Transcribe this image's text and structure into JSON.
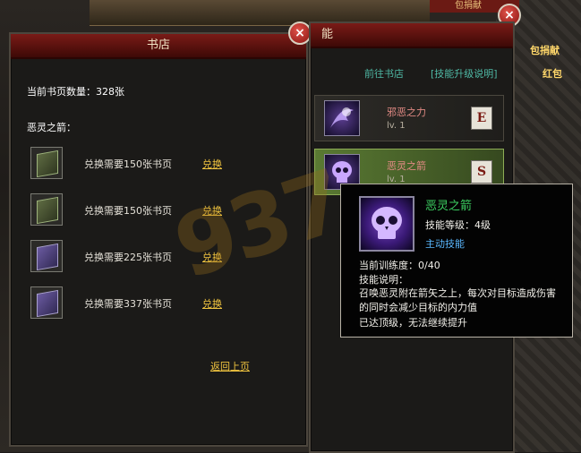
{
  "bookstore": {
    "title": "书店",
    "close_glyph": "×",
    "count_label": "当前书页数量：328张",
    "section_label": "恶灵之箭：",
    "items": [
      {
        "text": "兑换需要150张书页",
        "action": "兑换",
        "icon": "book-icon",
        "color": "#9db37b"
      },
      {
        "text": "兑换需要150张书页",
        "action": "兑换",
        "icon": "book-icon",
        "color": "#9db37b"
      },
      {
        "text": "兑换需要225张书页",
        "action": "兑换",
        "icon": "book-icon",
        "color": "#a89fce"
      },
      {
        "text": "兑换需要337张书页",
        "action": "兑换",
        "icon": "book-icon",
        "color": "#a89fce"
      }
    ],
    "back_link": "返回上页"
  },
  "skills": {
    "title_partial": "能",
    "close_glyph": "×",
    "goto_store": "前往书店",
    "upgrade_help": "[技能升级说明]",
    "list": [
      {
        "name": "邪恶之力",
        "level": "lv. 1",
        "key": "E",
        "icon": "evil-power-icon"
      },
      {
        "name": "恶灵之箭",
        "level": "lv. 1",
        "key": "S",
        "icon": "skull-icon"
      }
    ]
  },
  "tooltip": {
    "name": "恶灵之箭",
    "level_label": "技能等级：",
    "level_value": "4级",
    "type": "主动技能",
    "training_label": "当前训练度：",
    "training_value": "0/40",
    "desc_label": "技能说明：",
    "description": "召唤恶灵附在箭矢之上，每次对目标造成伤害的同时会减少目标的内力值",
    "max_note": "已达顶级，无法继续提升"
  },
  "background": {
    "top_strip": "包捐献",
    "side_text": "红包"
  },
  "watermark": "937"
}
